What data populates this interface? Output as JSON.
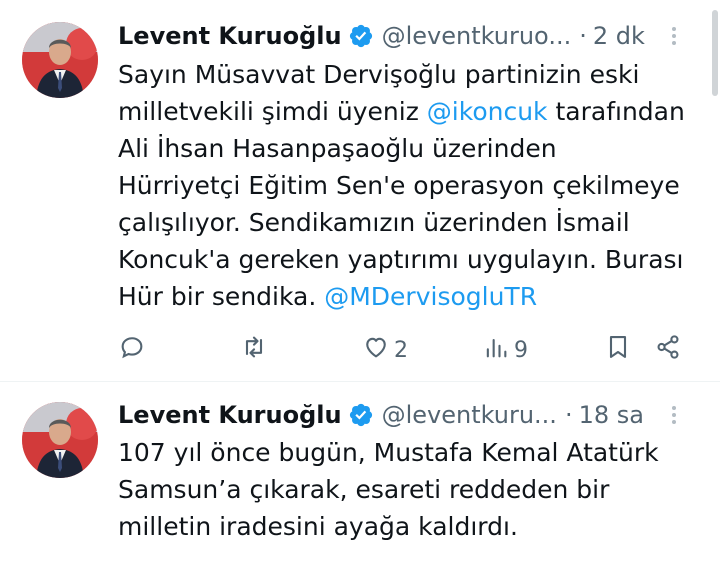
{
  "tweets": [
    {
      "author_name": "Levent Kuruoğlu",
      "handle": "@leventkuruo...",
      "separator": "·",
      "time": "2 dk",
      "text_lines": [
        [
          {
            "t": "Sayın Müsavvat Dervişoğlu partinizin eski",
            "m": false
          }
        ],
        [
          {
            "t": "milletvekili şimdi üyeniz ",
            "m": false
          },
          {
            "t": "@ikoncuk",
            "m": true
          },
          {
            "t": " tarafından",
            "m": false
          }
        ],
        [
          {
            "t": "Ali İhsan Hasanpaşaoğlu üzerinden",
            "m": false
          }
        ],
        [
          {
            "t": "Hürriyetçi Eğitim Sen'e operasyon çekilmeye",
            "m": false
          }
        ],
        [
          {
            "t": "çalışılıyor. Sendikamızın üzerinden İsmail",
            "m": false
          }
        ],
        [
          {
            "t": "Koncuk'a gereken yaptırımı uygulayın. Burası",
            "m": false
          }
        ],
        [
          {
            "t": "Hür bir sendika. ",
            "m": false
          },
          {
            "t": "@MDervisogluTR",
            "m": true
          }
        ]
      ],
      "actions": {
        "reply_count": "",
        "retweet_count": "",
        "like_count": "2",
        "views_count": "9"
      }
    },
    {
      "author_name": "Levent Kuruoğlu",
      "handle": "@leventkuru...",
      "separator": "·",
      "time": "18 sa",
      "text_lines": [
        [
          {
            "t": "107 yıl önce bugün, Mustafa Kemal Atatürk",
            "m": false
          }
        ],
        [
          {
            "t": "Samsun’a çıkarak, esareti reddeden bir",
            "m": false
          }
        ],
        [
          {
            "t": "milletin iradesini ayağa kaldırdı.",
            "m": false
          }
        ]
      ]
    }
  ],
  "colors": {
    "text": "#0f1419",
    "secondary": "#536471",
    "link": "#1d9bf0",
    "verified": "#1d9bf0",
    "divider": "#eff3f4"
  },
  "icons": [
    "verified-badge-icon",
    "more-icon",
    "reply-icon",
    "retweet-icon",
    "like-icon",
    "views-icon",
    "bookmark-icon",
    "share-icon"
  ]
}
